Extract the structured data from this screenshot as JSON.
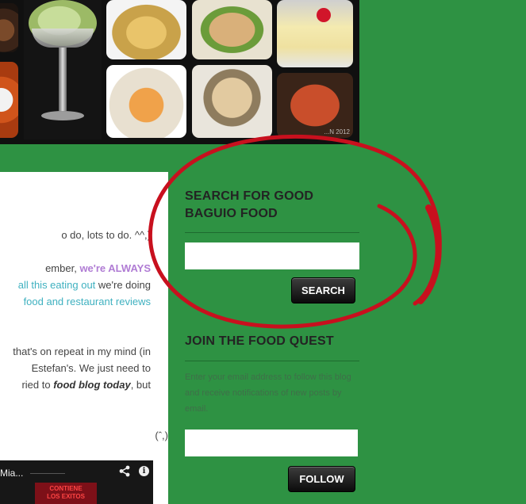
{
  "collage": {
    "watermark": "...N 2012",
    "tiles": [
      "food-photo",
      "food-photo",
      "ice-cream-photo",
      "noodles-photo",
      "fried-dish-photo",
      "shake-photo",
      "combo-plate-photo",
      "noodle-soup-photo",
      "pasta-photo"
    ]
  },
  "post": {
    "lines": [
      "o do, lots to do. ^^,)",
      "ember, ",
      "we're ALWAYS",
      "all this eating out",
      " we're doing",
      "food and restaurant reviews",
      "that's on repeat in my mind (in",
      "Estefan's. We just need to",
      "ried to ",
      "food blog today",
      ", but",
      "(ˆ,)"
    ],
    "video": {
      "title": "Mia...",
      "banner_line1": "CONTIENE",
      "banner_line2": "LOS EXITOS"
    }
  },
  "sidebar": {
    "search_widget": {
      "title": "SEARCH FOR GOOD BAGUIO FOOD",
      "input_value": "",
      "button_label": "SEARCH"
    },
    "follow_widget": {
      "title": "JOIN THE FOOD QUEST",
      "description": "Enter your email address to follow this blog and receive notifications of new posts by email.",
      "input_value": "",
      "button_label": "FOLLOW"
    }
  },
  "colors": {
    "background": "#2e9243",
    "annotation": "#c8101e",
    "link_purple": "#b07cd4",
    "link_teal": "#3fb1c0"
  }
}
